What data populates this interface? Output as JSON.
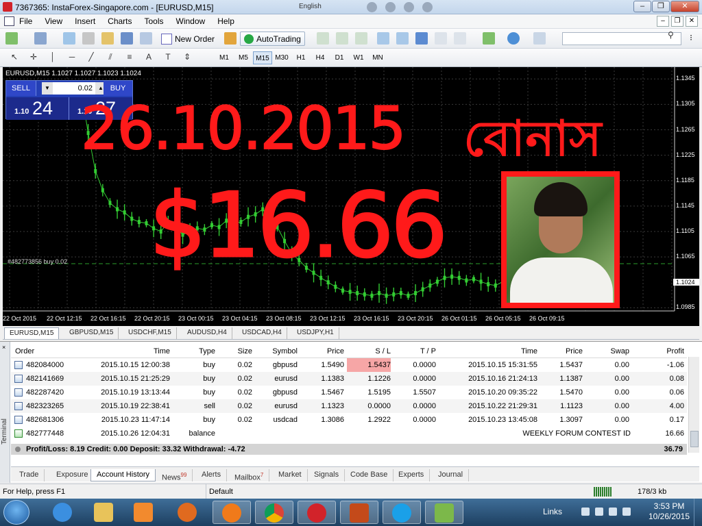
{
  "window": {
    "title": "7367365: InstaForex-Singapore.com - [EURUSD,M15]",
    "language": "English",
    "min_label": "–",
    "max_label": "❐",
    "close_label": "✕"
  },
  "menu": {
    "items": [
      "File",
      "View",
      "Insert",
      "Charts",
      "Tools",
      "Window",
      "Help"
    ],
    "mdi_min": "–",
    "mdi_restore": "❐",
    "mdi_close": "✕"
  },
  "toolbar": {
    "new_order_label": "New Order",
    "autotrading_label": "AutoTrading",
    "search_placeholder": "",
    "search_icon": "⚲",
    "more_icon": "⁝"
  },
  "periods": [
    "M1",
    "M5",
    "M15",
    "M30",
    "H1",
    "H4",
    "D1",
    "W1",
    "MN"
  ],
  "active_period": "M15",
  "chart": {
    "header": "EURUSD,M15  1.1027 1.1027 1.1023 1.1024",
    "trade_line_label": "#482773856 buy 0.02",
    "current_price": "1.1024",
    "bg_color": "#000000",
    "candle_color": "#33cc33"
  },
  "one_click": {
    "sell_label": "SELL",
    "buy_label": "BUY",
    "volume": "0.02",
    "sell_small": "1.10",
    "sell_big": "24",
    "buy_small": "1.10",
    "buy_big": "27"
  },
  "chart_data": {
    "type": "line",
    "series": [
      {
        "values": [
          1.133,
          1.126,
          1.12,
          1.117,
          1.115,
          1.114,
          1.1135,
          1.1125,
          1.112,
          1.1118,
          1.111,
          1.1105,
          1.112,
          1.1112,
          1.11,
          1.1105,
          1.111,
          1.1108,
          1.1115,
          1.1112,
          1.1122,
          1.1118,
          1.112,
          1.1128,
          1.1132,
          1.114,
          1.1128,
          1.1112,
          1.109,
          1.107,
          1.106,
          1.1048,
          1.104,
          1.1032,
          1.1025,
          1.1018,
          1.1012,
          1.101,
          1.1008,
          1.1006,
          1.1004,
          1.1008,
          1.1004,
          1.1006,
          1.1008,
          1.1004,
          1.1008,
          1.1014,
          1.102,
          1.1026,
          1.1032,
          1.1034,
          1.1032,
          1.1028,
          1.103,
          1.1026,
          1.1022,
          1.102,
          1.1026,
          1.1024
        ]
      }
    ],
    "x_ticks": [
      "22 Oct 2015",
      "22 Oct 12:15",
      "22 Oct 16:15",
      "22 Oct 20:15",
      "23 Oct 00:15",
      "23 Oct 04:15",
      "23 Oct 08:15",
      "23 Oct 12:15",
      "23 Oct 16:15",
      "23 Oct 20:15",
      "26 Oct 01:15",
      "26 Oct 05:15",
      "26 Oct 09:15"
    ],
    "y_ticks": [
      "1.1345",
      "1.1305",
      "1.1265",
      "1.1225",
      "1.1185",
      "1.1145",
      "1.1105",
      "1.1065",
      "1.0985"
    ],
    "ylim": [
      1.098,
      1.1355
    ],
    "grid": true
  },
  "symbol_tabs": [
    "EURUSD,M15",
    "GBPUSD,M15",
    "USDCHF,M15",
    "AUDUSD,H4",
    "USDCAD,H4",
    "USDJPY,H1"
  ],
  "history": {
    "columns": [
      "Order",
      "Time",
      "Type",
      "Size",
      "Symbol",
      "Price",
      "S / L",
      "T / P",
      "Time",
      "Price",
      "Swap",
      "Profit"
    ],
    "rows": [
      [
        "482084000",
        "2015.10.15 12:00:38",
        "buy",
        "0.02",
        "gbpusd",
        "1.5490",
        "1.5437",
        "0.0000",
        "2015.10.15 15:31:55",
        "1.5437",
        "0.00",
        "-1.06"
      ],
      [
        "482141669",
        "2015.10.15 21:25:29",
        "buy",
        "0.02",
        "eurusd",
        "1.1383",
        "1.1226",
        "0.0000",
        "2015.10.16 21:24:13",
        "1.1387",
        "0.00",
        "0.08"
      ],
      [
        "482287420",
        "2015.10.19 13:13:44",
        "buy",
        "0.02",
        "gbpusd",
        "1.5467",
        "1.5195",
        "1.5507",
        "2015.10.20 09:35:22",
        "1.5470",
        "0.00",
        "0.06"
      ],
      [
        "482323265",
        "2015.10.19 22:38:41",
        "sell",
        "0.02",
        "eurusd",
        "1.1323",
        "0.0000",
        "0.0000",
        "2015.10.22 21:29:31",
        "1.1123",
        "0.00",
        "4.00"
      ],
      [
        "482681306",
        "2015.10.23 11:47:14",
        "buy",
        "0.02",
        "usdcad",
        "1.3086",
        "1.2922",
        "0.0000",
        "2015.10.23 13:45:08",
        "1.3097",
        "0.00",
        "0.17"
      ]
    ],
    "balance_row": {
      "order": "482777448",
      "time": "2015.10.26 12:04:31",
      "type": "balance",
      "comment": "WEEKLY FORUM CONTEST ID",
      "profit": "16.66"
    },
    "summary": "Profit/Loss: 8.19  Credit: 0.00  Deposit: 33.32  Withdrawal: -4.72",
    "total": "36.79"
  },
  "terminal": {
    "side_label": "Terminal",
    "close": "×",
    "tabs": [
      "Trade",
      "Exposure",
      "Account History",
      "News",
      "Alerts",
      "Mailbox",
      "Market",
      "Signals",
      "Code Base",
      "Experts",
      "Journal"
    ],
    "news_count": "99",
    "mailbox_count": "7",
    "active_tab": "Account History"
  },
  "status": {
    "help": "For Help, press F1",
    "profile": "Default",
    "traffic": "178/3 kb"
  },
  "annotations": {
    "date": "26.10.2015",
    "bonus_word": "বোনাস",
    "amount": "$16.66",
    "color": "#ff1a1a"
  },
  "taskbar": {
    "links": "Links",
    "time": "3:53 PM",
    "date": "10/26/2015"
  }
}
